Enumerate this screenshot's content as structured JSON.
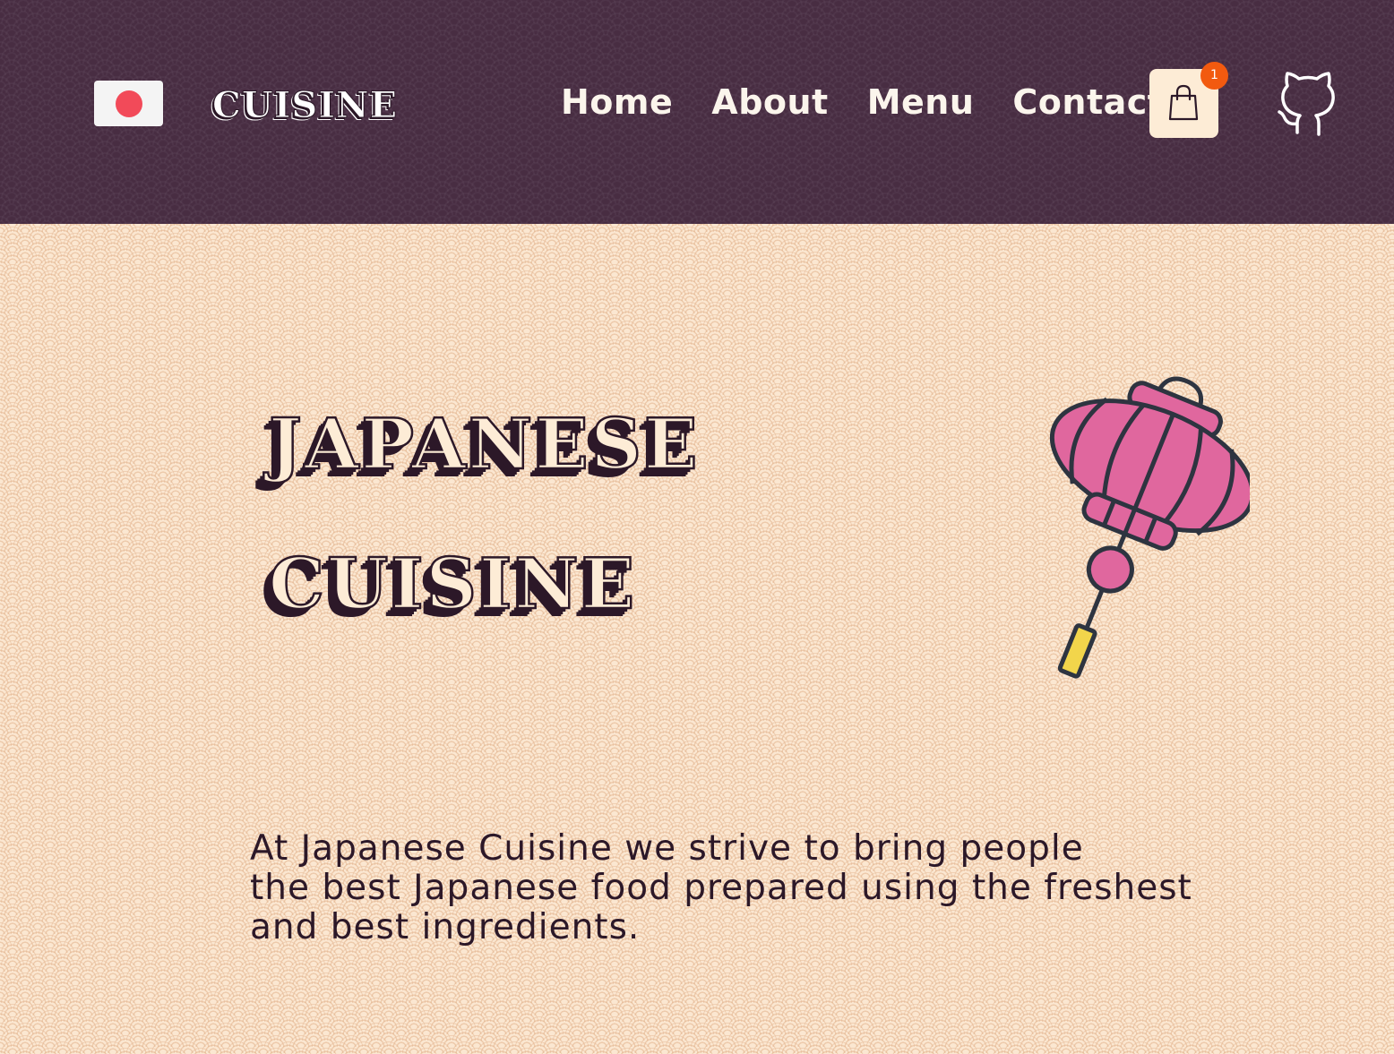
{
  "header": {
    "logo_text": "CUISINE",
    "nav": {
      "home": "Home",
      "about": "About",
      "menu": "Menu",
      "contact": "Contact"
    },
    "cart_count": "1",
    "flag_icon": "japan-flag-icon",
    "cart_icon": "shopping-bag-icon",
    "github_icon": "github-icon"
  },
  "hero": {
    "title_line1": "JAPANESE",
    "title_line2": "CUISINE",
    "illustration": "paper-lantern-icon",
    "tagline": "At Japanese Cuisine we strive to bring people\nthe best Japanese food prepared using the freshest\nand best ingredients."
  },
  "colors": {
    "header_bg": "#482d42",
    "page_bg": "#fbe7d1",
    "accent_pink": "#e0679e",
    "badge_orange": "#f25a0f",
    "flag_red": "#f24a59"
  }
}
